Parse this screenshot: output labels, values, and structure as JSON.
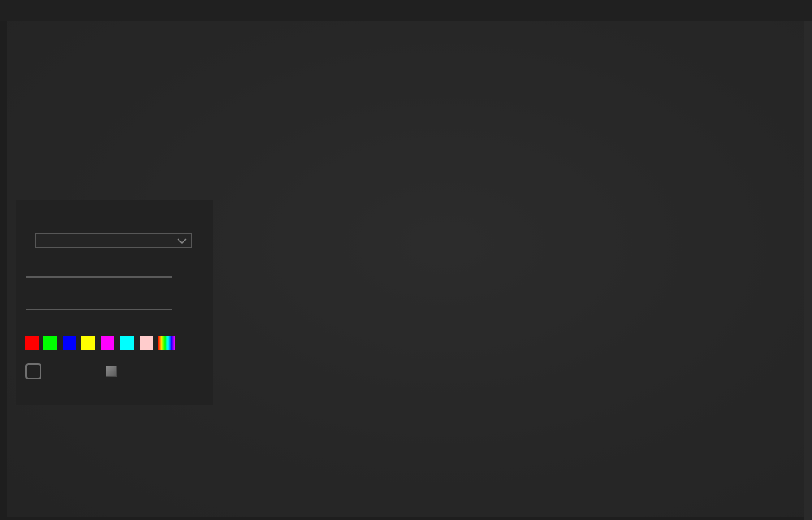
{
  "app": {
    "colors": {
      "topbar": "#202020",
      "canvas": "#282828",
      "panel": "#222222",
      "control_border": "#575757"
    }
  },
  "toolbar": {
    "brush_select": {
      "selected_value": "",
      "icon": "chevron-down-icon"
    },
    "size_slider": {
      "value": ""
    },
    "opacity_slider": {
      "value": ""
    },
    "palette": [
      {
        "name": "red",
        "color": "#ff0000"
      },
      {
        "name": "green",
        "color": "#00ff00"
      },
      {
        "name": "blue",
        "color": "#0000ff"
      },
      {
        "name": "yellow",
        "color": "#ffff00"
      },
      {
        "name": "magenta",
        "color": "#ff00ff"
      },
      {
        "name": "cyan",
        "color": "#00ffff"
      },
      {
        "name": "pink",
        "color": "#ffcccc"
      },
      {
        "name": "rainbow",
        "color": "rainbow"
      }
    ],
    "fill_checkbox": {
      "checked": false
    },
    "background_color": {
      "color": "#6e6e6e"
    }
  }
}
